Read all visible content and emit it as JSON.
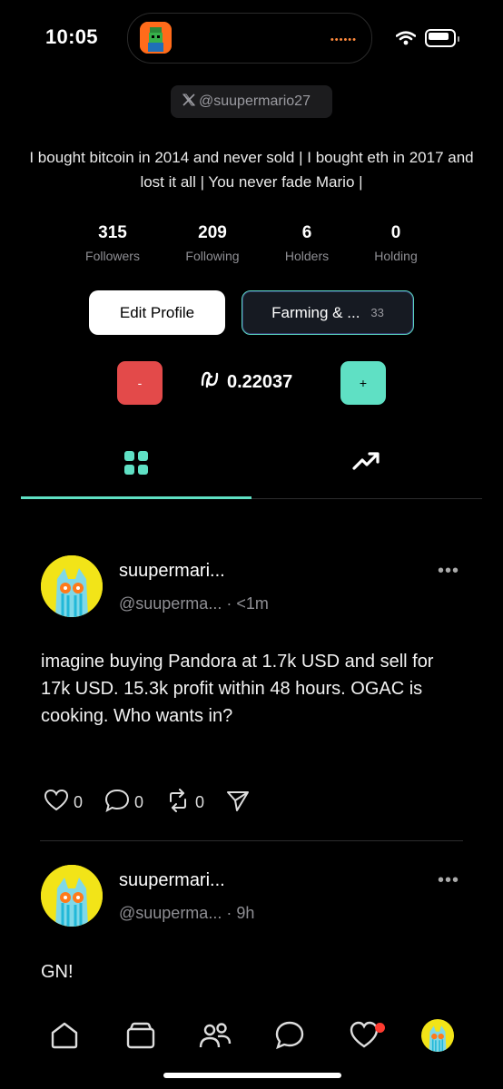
{
  "status_bar": {
    "time": "10:05",
    "island_indicator": "••••••"
  },
  "profile": {
    "handle": "@suupermario27",
    "bio": "I bought bitcoin in 2014 and never sold | I bought eth in 2017 and lost it all | You never fade Mario |",
    "stats": [
      {
        "value": "315",
        "label": "Followers"
      },
      {
        "value": "209",
        "label": "Following"
      },
      {
        "value": "6",
        "label": "Holders"
      },
      {
        "value": "0",
        "label": "Holding"
      }
    ],
    "edit_button": "Edit Profile",
    "farming_button": "Farming & ...",
    "farming_count": "33",
    "minus_label": "-",
    "plus_label": "+",
    "price": "0.22037"
  },
  "tabs": {
    "active": "grid-tab",
    "items": [
      "grid",
      "trending"
    ]
  },
  "posts": [
    {
      "name": "suupermari...",
      "handle": "@suuperma...",
      "time": "· <1m",
      "text": "imagine buying Pandora at 1.7k USD and sell for 17k USD. 15.3k profit within 48 hours. OGAC is cooking. Who wants in?",
      "likes": "0",
      "comments": "0",
      "reposts": "0",
      "more": "•••"
    },
    {
      "name": "suupermari...",
      "handle": "@suuperma...",
      "time": "· 9h",
      "text": "GN!",
      "more": "•••"
    }
  ],
  "bottom_nav": [
    "home-icon",
    "wallet-icon",
    "people-icon",
    "chat-icon",
    "heart-icon",
    "avatar"
  ],
  "colors": {
    "accent": "#5fe0c4",
    "danger": "#e34a4a",
    "avatar_yellow": "#f2e418"
  }
}
